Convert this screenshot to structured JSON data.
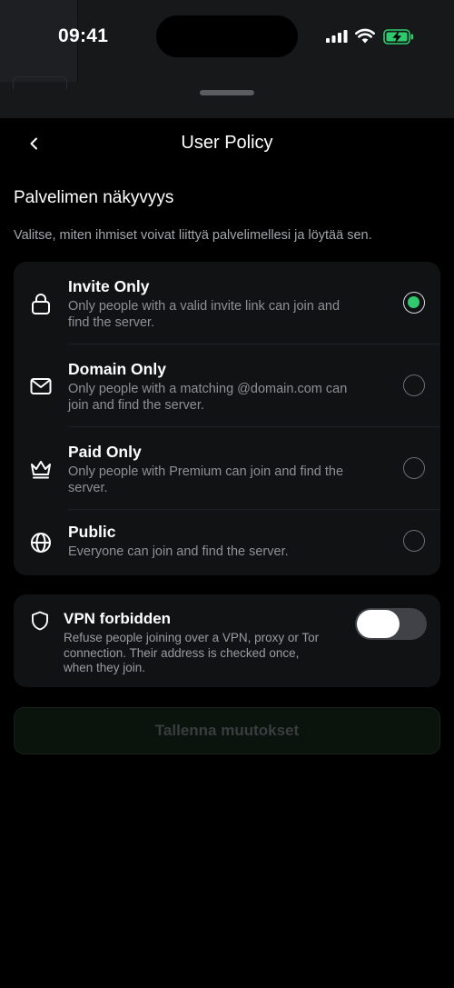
{
  "status_bar": {
    "time": "09:41",
    "icons": [
      "cellular-signal-icon",
      "wifi-icon",
      "battery-charging-icon"
    ],
    "battery_color": "#2fca6e"
  },
  "header": {
    "title": "User Policy",
    "back_icon": "chevron-left-icon"
  },
  "section": {
    "title": "Palvelimen näkyvyys",
    "description": "Valitse, miten ihmiset voivat liittyä palvelimellesi ja löytää sen."
  },
  "options": [
    {
      "label": "Invite Only",
      "description": "Only people with a valid invite link can join and find the server.",
      "icon": "lock-icon",
      "selected": true
    },
    {
      "label": "Domain Only",
      "description": "Only people with a matching @domain.com can join and find the server.",
      "icon": "mail-icon",
      "selected": false
    },
    {
      "label": "Paid Only",
      "description": "Only people with Premium can join and find the server.",
      "icon": "crown-icon",
      "selected": false
    },
    {
      "label": "Public",
      "description": "Everyone can join and find the server.",
      "icon": "globe-icon",
      "selected": false
    }
  ],
  "vpn": {
    "label": "VPN forbidden",
    "description": "Refuse people joining over a VPN, proxy or Tor connection. Their address is checked once, when they join.",
    "icon": "shield-icon",
    "enabled": false
  },
  "save_button": {
    "label": "Tallenna muutokset",
    "disabled": true
  },
  "colors": {
    "accent": "#2fca6e",
    "card_background": "#111214",
    "secondary_text": "#8e9095"
  }
}
